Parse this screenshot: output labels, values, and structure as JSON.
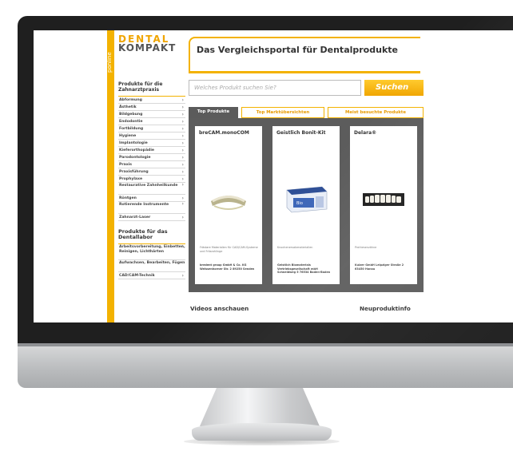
{
  "site": {
    "side_text": "ponline",
    "logo_line1": "DENTAL",
    "logo_line2": "KOMPAKT",
    "tagline": "Das Vergleichsportal für Dentalprodukte"
  },
  "search": {
    "placeholder": "Welches Produkt suchen Sie?",
    "button_label": "Suchen"
  },
  "sidebar": {
    "section1_title": "Produkte für die Zahnarztpraxis",
    "section1_items": [
      "Abformung",
      "Ästhetik",
      "Bildgebung",
      "Endodontie",
      "Fortbildung",
      "Hygiene",
      "Implantologie",
      "Kieferorthopädie",
      "Parodontologie",
      "Praxis",
      "Praxisführung",
      "Prophylaxe",
      "Restaurative Zahnheilkunde",
      "Röntgen",
      "Rotierende Instrumente",
      "Zahnarzt-Laser"
    ],
    "section2_title": "Produkte für das Dentallabor",
    "section2_items": [
      "Arbeitsvorbereitung, Einbetten, Reinigen, Lichthärten",
      "Aufwachsen, Bearbeiten, Fügen",
      "CAD/CAM-Technik"
    ]
  },
  "tabs": [
    {
      "label": "Top Produkte"
    },
    {
      "label": "Top Marktübersichten"
    },
    {
      "label": "Meist besuchte Produkte"
    }
  ],
  "products": [
    {
      "title": "breCAM.monoCOM",
      "description": "Frästare Materialien für CAD/CAM-Systeme und Fräsrohlinge",
      "address": "bredent group GmbH & Co. KG Weissenhorner Str. 2 89250 Senden"
    },
    {
      "title": "Geistlich Bonit-Kit",
      "description": "Knochenersatzmaterialien",
      "address": "Geistlich Biomaterials Vertriebsgesellschaft mbH Schneidweg 5 76534 Baden-Baden"
    },
    {
      "title": "Delara®",
      "description": "Prothesenzähne",
      "address": "Kulzer GmbH Leipziger Straße 2 63450 Hanau"
    }
  ],
  "bottom": {
    "videos": "Videos anschauen",
    "news": "Neuproduktinfo"
  },
  "colors": {
    "accent": "#f3b200",
    "panel": "#5c5c5c",
    "bezel": "#1f1f1f"
  }
}
